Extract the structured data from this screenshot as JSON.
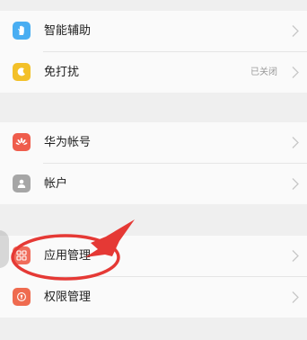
{
  "settings": {
    "group1": [
      {
        "id": "smart-assist",
        "label": "智能辅助",
        "value": "",
        "icon": "hand-icon",
        "icon_color": "#49aef2"
      },
      {
        "id": "do-not-disturb",
        "label": "免打扰",
        "value": "已关闭",
        "icon": "moon-icon",
        "icon_color": "#f3c028"
      }
    ],
    "group2": [
      {
        "id": "huawei-account",
        "label": "华为帐号",
        "value": "",
        "icon": "huawei-logo-icon",
        "icon_color": "#ef5d4c"
      },
      {
        "id": "accounts",
        "label": "帐户",
        "value": "",
        "icon": "person-icon",
        "icon_color": "#a6a6a6"
      }
    ],
    "group3": [
      {
        "id": "app-management",
        "label": "应用管理",
        "value": "",
        "icon": "apps-grid-icon",
        "icon_color": "#f06c5b"
      },
      {
        "id": "permission-management",
        "label": "权限管理",
        "value": "",
        "icon": "shield-icon",
        "icon_color": "#ef6b4f"
      }
    ]
  },
  "annotation": {
    "highlight_color": "#e53935",
    "highlighted_item": "应用管理"
  }
}
